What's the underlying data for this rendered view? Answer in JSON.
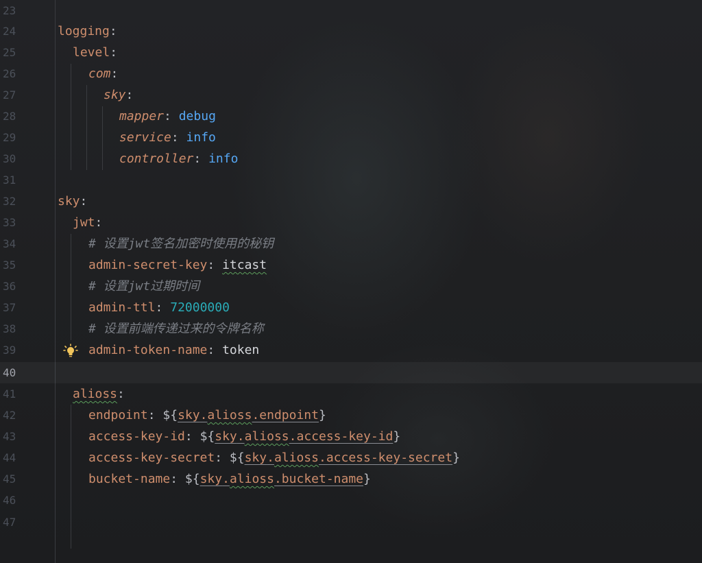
{
  "editor": {
    "current_line": "40",
    "lines": [
      {
        "no": "23"
      },
      {
        "no": "24",
        "t1": "logging",
        "t2": ":"
      },
      {
        "no": "25",
        "t1": "level",
        "t2": ":"
      },
      {
        "no": "26",
        "t1": "com",
        "t2": ":"
      },
      {
        "no": "27",
        "t1": "sky",
        "t2": ":"
      },
      {
        "no": "28",
        "t1": "mapper",
        "t2": ": ",
        "t3": "debug"
      },
      {
        "no": "29",
        "t1": "service",
        "t2": ": ",
        "t3": "info"
      },
      {
        "no": "30",
        "t1": "controller",
        "t2": ": ",
        "t3": "info"
      },
      {
        "no": "31"
      },
      {
        "no": "32",
        "t1": "sky",
        "t2": ":"
      },
      {
        "no": "33",
        "t1": "jwt",
        "t2": ":"
      },
      {
        "no": "34",
        "c": "# 设置jwt签名加密时使用的秘钥"
      },
      {
        "no": "35",
        "t1": "admin-secret-key",
        "t2": ": ",
        "t3": "itcast"
      },
      {
        "no": "36",
        "c": "# 设置jwt过期时间"
      },
      {
        "no": "37",
        "t1": "admin-ttl",
        "t2": ": ",
        "t3": "72000000"
      },
      {
        "no": "38",
        "c": "# 设置前端传递过来的令牌名称"
      },
      {
        "no": "39",
        "t1": "admin-token-name",
        "t2": ": ",
        "t3": "token"
      },
      {
        "no": "40"
      },
      {
        "no": "41",
        "t1": "alioss",
        "t2": ":"
      },
      {
        "no": "42",
        "t1": "endpoint",
        "t2": ": ${",
        "a": "sky",
        "b": ".",
        "cc": "alioss",
        ".": "",
        "d": ".endpoint",
        "e": "}"
      },
      {
        "no": "43",
        "t1": "access-key-id",
        "t2": ": ${",
        "a": "sky",
        "b": ".",
        "cc": "alioss",
        "d": ".access-key-id",
        "e": "}"
      },
      {
        "no": "44",
        "t1": "access-key-secret",
        "t2": ": ${",
        "a": "sky",
        "b": ".",
        "cc": "alioss",
        "d": ".access-key-secret",
        "e": "}"
      },
      {
        "no": "45",
        "t1": "bucket-name",
        "t2": ": ${",
        "a": "sky",
        "b": ".",
        "cc": "alioss",
        "d": ".bucket-name",
        "e": "}"
      },
      {
        "no": "46"
      },
      {
        "no": "47"
      }
    ]
  },
  "icons": {
    "intention": "lightbulb-icon"
  },
  "colors": {
    "key": "#cf8e6d",
    "value_keyword": "#56a8f5",
    "number": "#2aacb8",
    "comment": "#7a7e85",
    "text": "#bcbec4"
  }
}
